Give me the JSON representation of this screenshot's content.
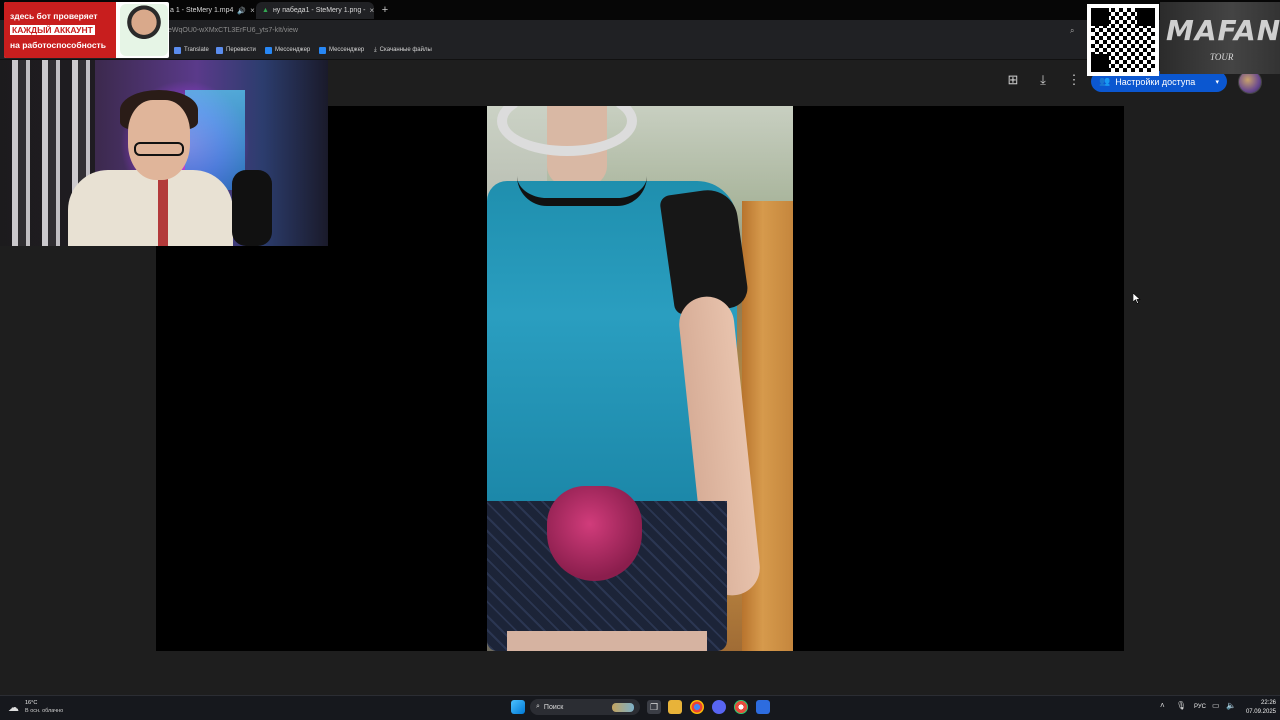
{
  "browser": {
    "tabs": [
      {
        "title": "а 1 - SteMery 1.mp4",
        "audio_icon": "speaker-icon",
        "close": "×"
      },
      {
        "title": "ну пабеда1 - SteMery 1.png - ",
        "close": "×"
      }
    ],
    "new_tab": "+",
    "url": "eWqOU0-wXMxCTL3ErFU6_yts7-kIt/view",
    "bookmarks": [
      {
        "label": "Translate",
        "icon": "translate-icon"
      },
      {
        "label": "Перевести",
        "icon": "translate-icon"
      },
      {
        "label": "Мессенджер",
        "icon": "vk-icon"
      },
      {
        "label": "Мессенджер",
        "icon": "vk-icon"
      },
      {
        "label": "Скачанные файлы",
        "icon": "download-icon"
      }
    ]
  },
  "viewer": {
    "toolbar_icons": [
      "add-to-drive-icon",
      "download-icon",
      "more-vert-icon"
    ],
    "share_button": "Настройки доступа",
    "share_arrow": "▾"
  },
  "overlay": {
    "promo_lines": [
      "здесь бот проверяет",
      "КАЖДЫЙ АККАУНТ",
      "на работоспособность"
    ],
    "sponsor_title": "MAFANYA",
    "sponsor_subtitle": "TOUR"
  },
  "taskbar": {
    "weather_temp": "16°C",
    "weather_desc": "В осн. облачно",
    "search_placeholder": "Поиск",
    "language": "РУС",
    "time": "22:26",
    "date": "07.09.2025"
  },
  "colors": {
    "share_button": "#0b57d0",
    "promo_red": "#c81e1e",
    "player_bg": "#000000",
    "viewer_bg": "#1e1e1e"
  }
}
